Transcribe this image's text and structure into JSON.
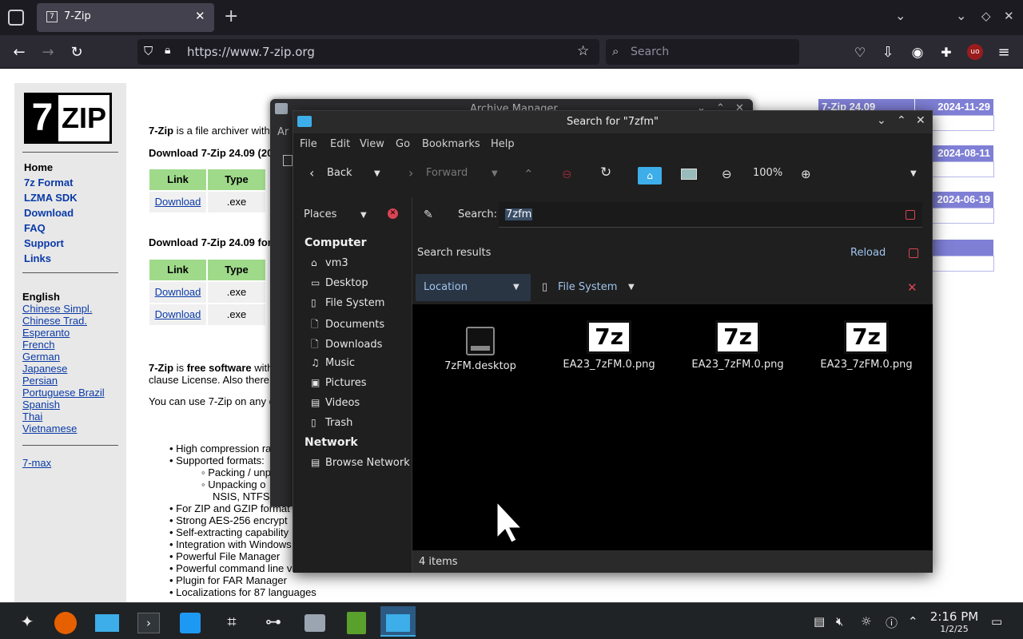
{
  "browser": {
    "tab_title": "7-Zip",
    "url": "https://www.7-zip.org",
    "search_placeholder": "Search",
    "ublock_label": "uo"
  },
  "page": {
    "logo": "7ZIP",
    "nav": [
      "Home",
      "7z Format",
      "LZMA SDK",
      "Download",
      "FAQ",
      "Support",
      "Links"
    ],
    "lang_title": "English",
    "languages": [
      "Chinese Simpl.",
      "Chinese Trad.",
      "Esperanto",
      "French",
      "German",
      "Japanese",
      "Persian",
      "Portuguese Brazil",
      "Spanish",
      "Thai",
      "Vietnamese"
    ],
    "seven_max": "7-max",
    "intro_bold": "7-Zip",
    "intro_rest": " is a file archiver with",
    "dl1_heading": "Download 7-Zip 24.09 (20",
    "dl2_heading": "Download 7-Zip 24.09 for",
    "col_link": "Link",
    "col_type": "Type",
    "download": "Download",
    "exe": ".exe",
    "free_bold1": "7-Zip",
    "free_mid": " is ",
    "free_bold2": "free software",
    "free_rest": " with",
    "clause": "clause License. Also there",
    "any": "You can use 7-Zip on any c",
    "features": [
      "High compression ra",
      "Supported formats:",
      "For ZIP and GZIP format",
      "Strong AES-256 encrypt",
      "Self-extracting capability",
      "Integration with Windows",
      "Powerful File Manager",
      "Powerful command line v",
      "Plugin for FAR Manager",
      "Localizations for 87 languages"
    ],
    "sub_features": [
      "Packing / unp",
      "Unpacking o"
    ],
    "nsis": "NSIS, NTFS,",
    "news": [
      {
        "title": "7-Zip 24.09",
        "date": "2024-11-29"
      },
      {
        "title": "",
        "date": "2024-08-11"
      },
      {
        "title": "",
        "date": "2024-06-19"
      }
    ]
  },
  "archive_window": {
    "title": "Archive Manager",
    "label": "Ar"
  },
  "window": {
    "title": "Search for \"7zfm\"",
    "menus": [
      "File",
      "Edit",
      "View",
      "Go",
      "Bookmarks",
      "Help"
    ],
    "back": "Back",
    "forward": "Forward",
    "zoom": "100%",
    "places_label": "Places",
    "search_label": "Search:",
    "search_value": "7zfm",
    "results_label": "Search results",
    "reload": "Reload",
    "location": "Location",
    "file_system": "File System",
    "computer": "Computer",
    "network": "Network",
    "places": [
      {
        "icon": "home-icon",
        "glyph": "⌂",
        "label": "vm3"
      },
      {
        "icon": "desktop-icon",
        "glyph": "▭",
        "label": "Desktop"
      },
      {
        "icon": "drive-icon",
        "glyph": "▯",
        "label": "File System"
      },
      {
        "icon": "documents-icon",
        "glyph": "🗋",
        "label": "Documents"
      },
      {
        "icon": "downloads-icon",
        "glyph": "🗋",
        "label": "Downloads"
      },
      {
        "icon": "music-icon",
        "glyph": "♫",
        "label": "Music"
      },
      {
        "icon": "pictures-icon",
        "glyph": "▣",
        "label": "Pictures"
      },
      {
        "icon": "videos-icon",
        "glyph": "▤",
        "label": "Videos"
      },
      {
        "icon": "trash-icon",
        "glyph": "▯",
        "label": "Trash"
      }
    ],
    "browse_network": "Browse Network",
    "files": [
      {
        "name": "7zFM.desktop",
        "thumb": ""
      },
      {
        "name": "EA23_7zFM.0.png",
        "thumb": "7z"
      },
      {
        "name": "EA23_7zFM.0.png",
        "thumb": "7z"
      },
      {
        "name": "EA23_7zFM.0.png",
        "thumb": "7z"
      }
    ],
    "status": "4 items"
  },
  "taskbar": {
    "time": "2:16 PM",
    "date": "1/2/25"
  }
}
